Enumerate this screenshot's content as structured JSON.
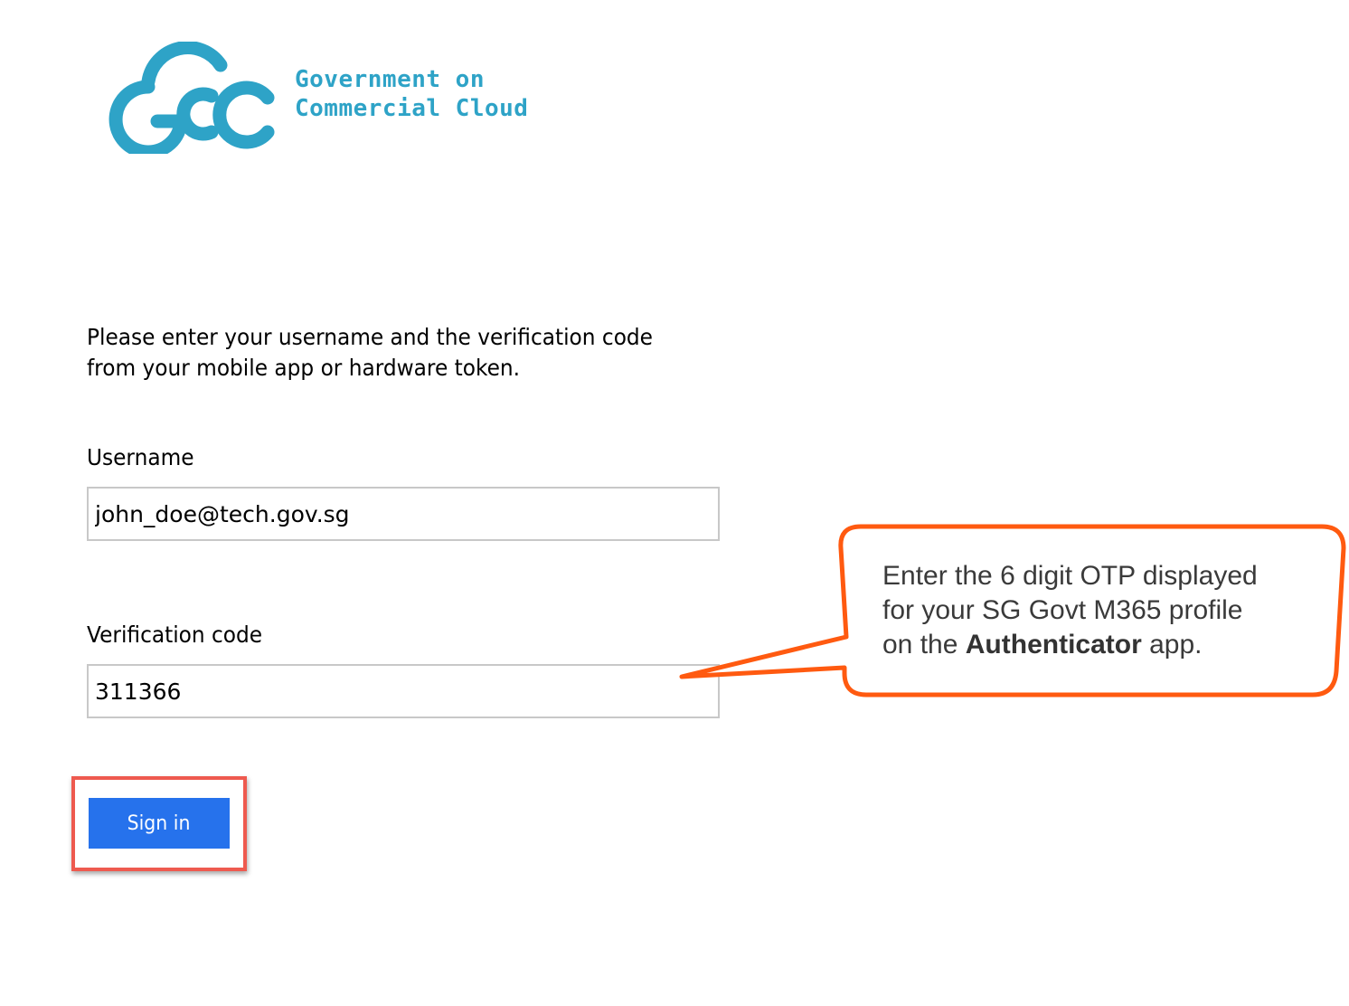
{
  "logo": {
    "line1": "Government on",
    "line2": "Commercial Cloud",
    "color": "#2ea3c7"
  },
  "instructions": {
    "line1": "Please enter your username and the verification code",
    "line2": "from your mobile app or hardware token."
  },
  "form": {
    "username_label": "Username",
    "username_value": "john_doe@tech.gov.sg",
    "code_label": "Verification code",
    "code_value": "311366",
    "signin_label": "Sign in",
    "button_color": "#2672ec"
  },
  "callout": {
    "line1": "Enter the 6 digit OTP displayed",
    "line2": "for your SG Govt M365 profile",
    "line3_prefix": "on the",
    "line3_bold": "Authenticator",
    "line3_suffix": "app.",
    "border_color": "#ff5a10",
    "highlight_color": "#ee5a4f"
  }
}
